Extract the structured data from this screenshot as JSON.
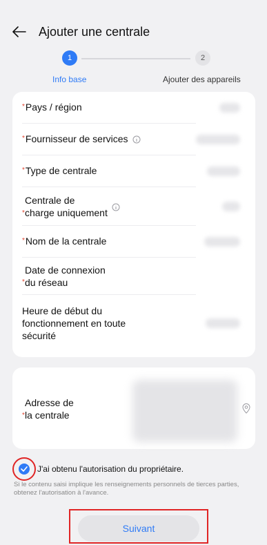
{
  "header": {
    "title": "Ajouter une centrale",
    "back_icon": "arrow-left-icon"
  },
  "stepper": {
    "steps": [
      {
        "number": "1",
        "label": "Info base",
        "active": true
      },
      {
        "number": "2",
        "label": "Ajouter des appareils",
        "active": false
      }
    ]
  },
  "form": {
    "required_mark": "*",
    "fields": [
      {
        "label": "Pays / région",
        "required": true
      },
      {
        "label": "Fournisseur de services",
        "required": true,
        "info_icon": "info-icon"
      },
      {
        "label": "Type de centrale",
        "required": true
      },
      {
        "label_line1": "Centrale de",
        "label_line2": "charge uniquement",
        "required": true,
        "info_icon": "info-icon"
      },
      {
        "label": "Nom de la centrale",
        "required": true
      },
      {
        "label_line1": "Date de connexion",
        "label_line2": "du réseau",
        "required": true
      },
      {
        "label_line1": "Heure de début du",
        "label_line2": "fonctionnement en toute",
        "label_line3": "sécurité",
        "required": false
      }
    ],
    "address": {
      "label_line1": "Adresse de",
      "label_line2": "la centrale",
      "required": true,
      "icon": "location-pin-icon"
    }
  },
  "consent": {
    "checked": true,
    "text": "J'ai obtenu l'autorisation du propriétaire.",
    "note": "Si le contenu saisi implique les renseignements personnels de tierces parties, obtenez l'autorisation à l'avance."
  },
  "next_button": {
    "label": "Suivant"
  },
  "colors": {
    "accent": "#2f7bf6",
    "required": "#e0442f",
    "highlight": "#e02424",
    "background": "#f1f1f3"
  }
}
